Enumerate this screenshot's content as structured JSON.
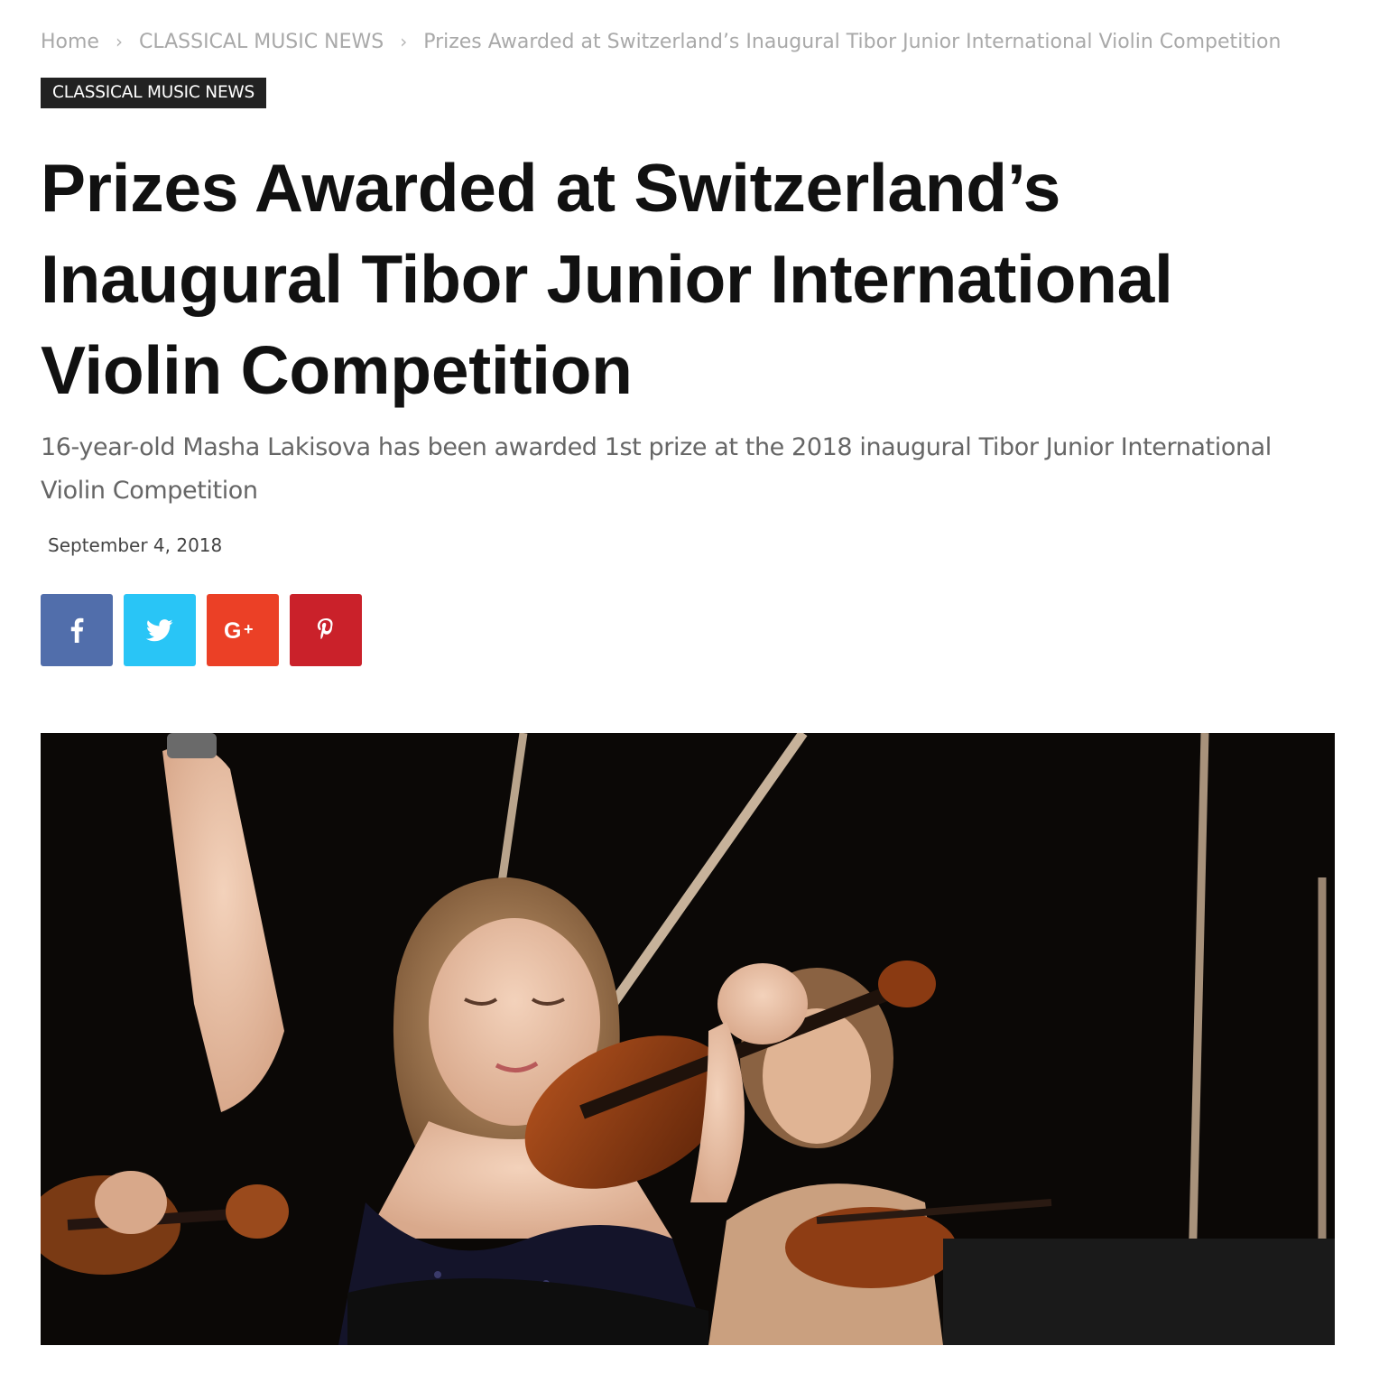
{
  "breadcrumb": {
    "items": [
      "Home",
      "CLASSICAL MUSIC NEWS",
      "Prizes Awarded at Switzerland’s Inaugural Tibor Junior International Violin Competition"
    ],
    "separator": "›"
  },
  "category": "CLASSICAL MUSIC NEWS",
  "article": {
    "title": "Prizes Awarded at Switzerland’s Inaugural Tibor Junior International Violin Competition",
    "subtitle": "16-year-old Masha Lakisova has been awarded 1st prize at the 2018 inaugural Tibor Junior International Violin Competition",
    "date": "September 4, 2018"
  },
  "share": {
    "buttons": [
      {
        "network": "facebook",
        "icon": "facebook-icon",
        "color": "#516eab"
      },
      {
        "network": "twitter",
        "icon": "twitter-icon",
        "color": "#29c5f6"
      },
      {
        "network": "google-plus",
        "icon": "google-plus-icon",
        "color": "#eb4026"
      },
      {
        "network": "pinterest",
        "icon": "pinterest-icon",
        "color": "#ca212a"
      }
    ]
  },
  "hero_image": {
    "description_icon": "violinist-photo",
    "background": "#0a0806"
  }
}
